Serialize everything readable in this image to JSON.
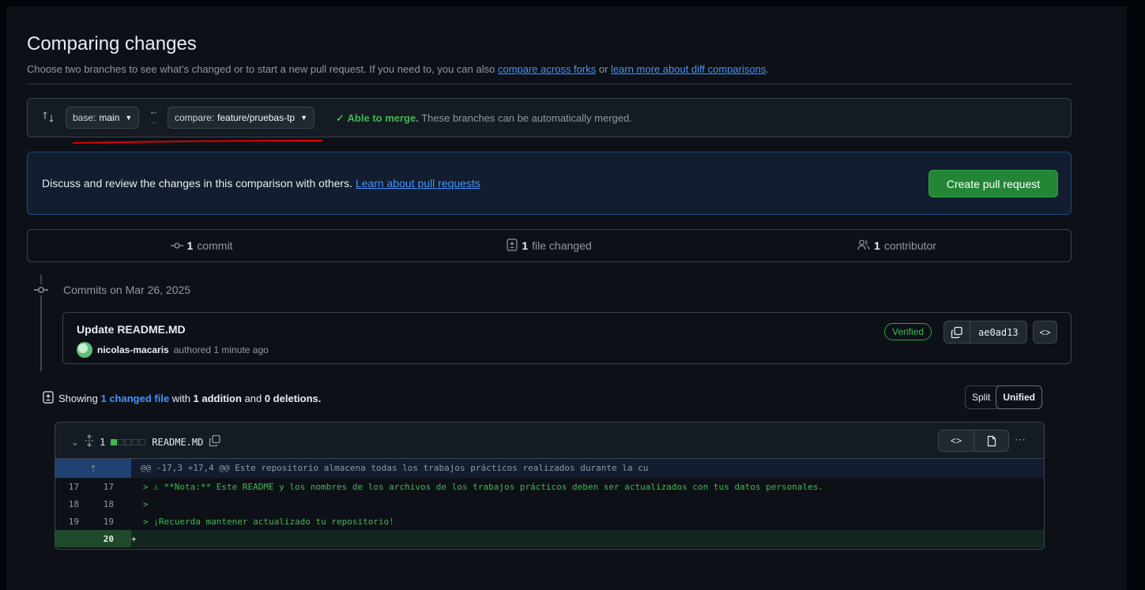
{
  "page": {
    "title": "Comparing changes",
    "subtitle_prefix": "Choose two branches to see what’s changed or to start a new pull request. If you need to, you can also ",
    "link_forks": "compare across forks",
    "subtitle_or": " or ",
    "link_learn_diff": "learn more about diff comparisons",
    "subtitle_end": "."
  },
  "range": {
    "base_key": "base:",
    "base_value": "main",
    "compare_key": "compare:",
    "compare_value": "feature/pruebas-tp",
    "arrow": "←",
    "dots": "...",
    "merge_status": "Able to merge.",
    "merge_text": " These branches can be automatically merged."
  },
  "discuss": {
    "text": "Discuss and review the changes in this comparison with others. ",
    "link": "Learn about pull requests",
    "button": "Create pull request"
  },
  "stats": {
    "commits_count": "1",
    "commits_label": "commit",
    "files_count": "1",
    "files_label": "file changed",
    "contributors_count": "1",
    "contributors_label": "contributor"
  },
  "commits": {
    "date_label": "Commits on Mar 26, 2025",
    "title": "Update README.MD",
    "author": "nicolas-macaris",
    "authored": "authored 1 minute ago",
    "verified": "Verified",
    "sha": "ae0ad13"
  },
  "summary": {
    "prefix": "Showing ",
    "changed_link": "1 changed file",
    "with": " with ",
    "additions": "1 addition",
    "and": " and ",
    "deletions": "0 deletions.",
    "split": "Split",
    "unified": "Unified"
  },
  "diff": {
    "changes_count": "1",
    "filename": "README.MD",
    "hunk_header": "@@ -17,3 +17,4 @@ Este repositorio almacena todas los trabajos prácticos realizados durante la cu",
    "lines": [
      {
        "old": "17",
        "new": "17",
        "text": "> ⚠ **Nota:** Este README y los nombres de los archivos de los trabajos prácticos deben ser actualizados con tus datos personales."
      },
      {
        "old": "18",
        "new": "18",
        "text": ">"
      },
      {
        "old": "19",
        "new": "19",
        "text": "> ¡Recuerda mantener actualizado tu repositorio!"
      }
    ],
    "added_line": {
      "new": "20",
      "text": "+"
    }
  },
  "colors": {
    "accent_link": "#4493f8",
    "success": "#3fb950",
    "primary_button": "#238636",
    "annotation_red": "#e00000"
  }
}
